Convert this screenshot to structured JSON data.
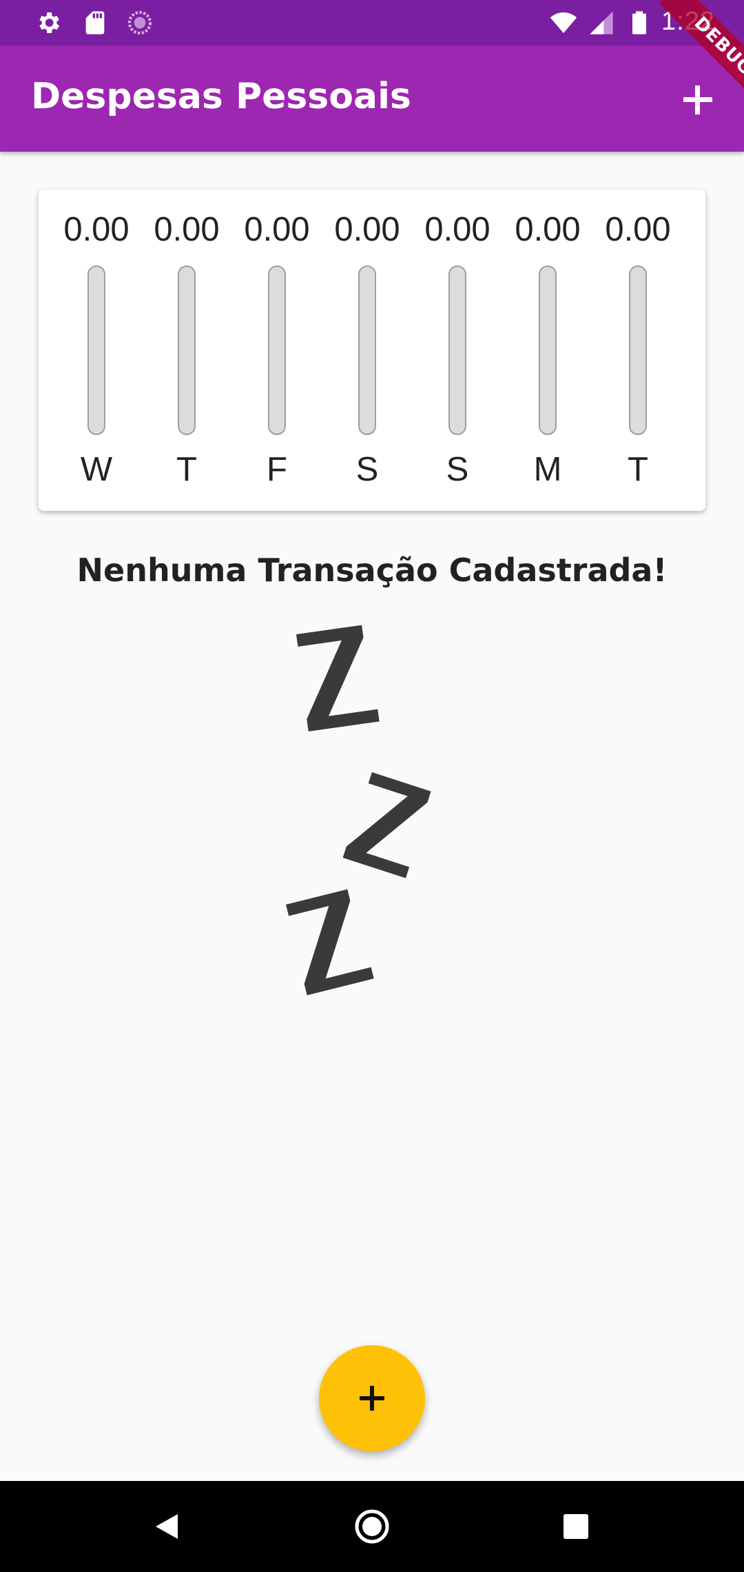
{
  "status_bar": {
    "time": "1:22",
    "icons": [
      "settings-icon",
      "sd-card-icon",
      "sync-icon",
      "wifi-icon",
      "signal-icon",
      "battery-icon"
    ]
  },
  "app_bar": {
    "title": "Despesas Pessoais",
    "action_icon": "add-icon"
  },
  "debug_banner": "DEBUG",
  "chart": {
    "bars": [
      {
        "label": "W",
        "value": "0.00",
        "fill_fraction": 0
      },
      {
        "label": "T",
        "value": "0.00",
        "fill_fraction": 0
      },
      {
        "label": "F",
        "value": "0.00",
        "fill_fraction": 0
      },
      {
        "label": "S",
        "value": "0.00",
        "fill_fraction": 0
      },
      {
        "label": "S",
        "value": "0.00",
        "fill_fraction": 0
      },
      {
        "label": "M",
        "value": "0.00",
        "fill_fraction": 0
      },
      {
        "label": "T",
        "value": "0.00",
        "fill_fraction": 0
      }
    ]
  },
  "empty_state": {
    "title": "Nenhuma Transação Cadastrada!",
    "image": "zzz-sleeping-image"
  },
  "fab": {
    "icon": "add-icon"
  },
  "nav_bar": {
    "icons": [
      "back-icon",
      "home-icon",
      "recents-icon"
    ]
  },
  "colors": {
    "primary": "#9c27b0",
    "primary_dark": "#7b1fa2",
    "accent": "#ffc107",
    "background": "#fafafa"
  }
}
